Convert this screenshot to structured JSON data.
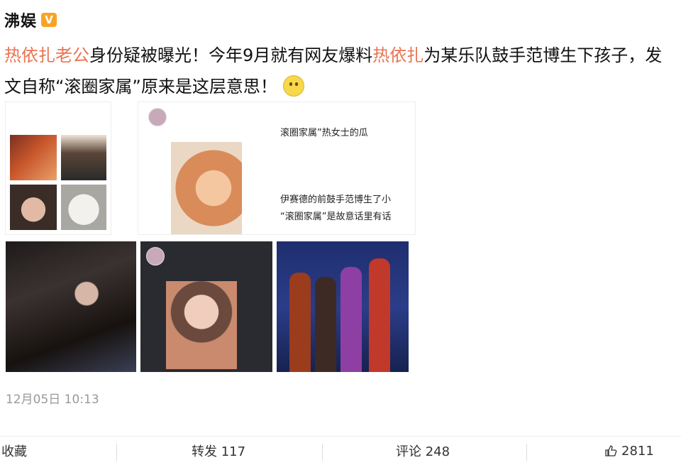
{
  "post": {
    "author": "沸娱",
    "verified_badge": "V",
    "text_parts": [
      {
        "text": "热依扎老公",
        "link": true
      },
      {
        "text": "身份疑被曝光！今年9月就有网友爆料",
        "link": false
      },
      {
        "text": "热依扎",
        "link": true
      },
      {
        "text": "为某乐队鼓手范博生下孩子，发文自称“滚圈家属”原来是这层意思！",
        "link": false
      }
    ],
    "emoji": "thinking-face",
    "timestamp": "12月05日 10:13"
  },
  "screenshot_right": {
    "line1": "滚圈家属”热女士的瓜",
    "line2": "伊赛德的前鼓手范博生了小",
    "line3": "“滚圈家属”是故意话里有话"
  },
  "actions": {
    "favorite": "收藏",
    "repost": "转发 117",
    "comment": "评论 248",
    "like": "2811"
  },
  "colors": {
    "link": "#eb7350",
    "badge": "#f7a425",
    "timestamp": "#999999"
  }
}
